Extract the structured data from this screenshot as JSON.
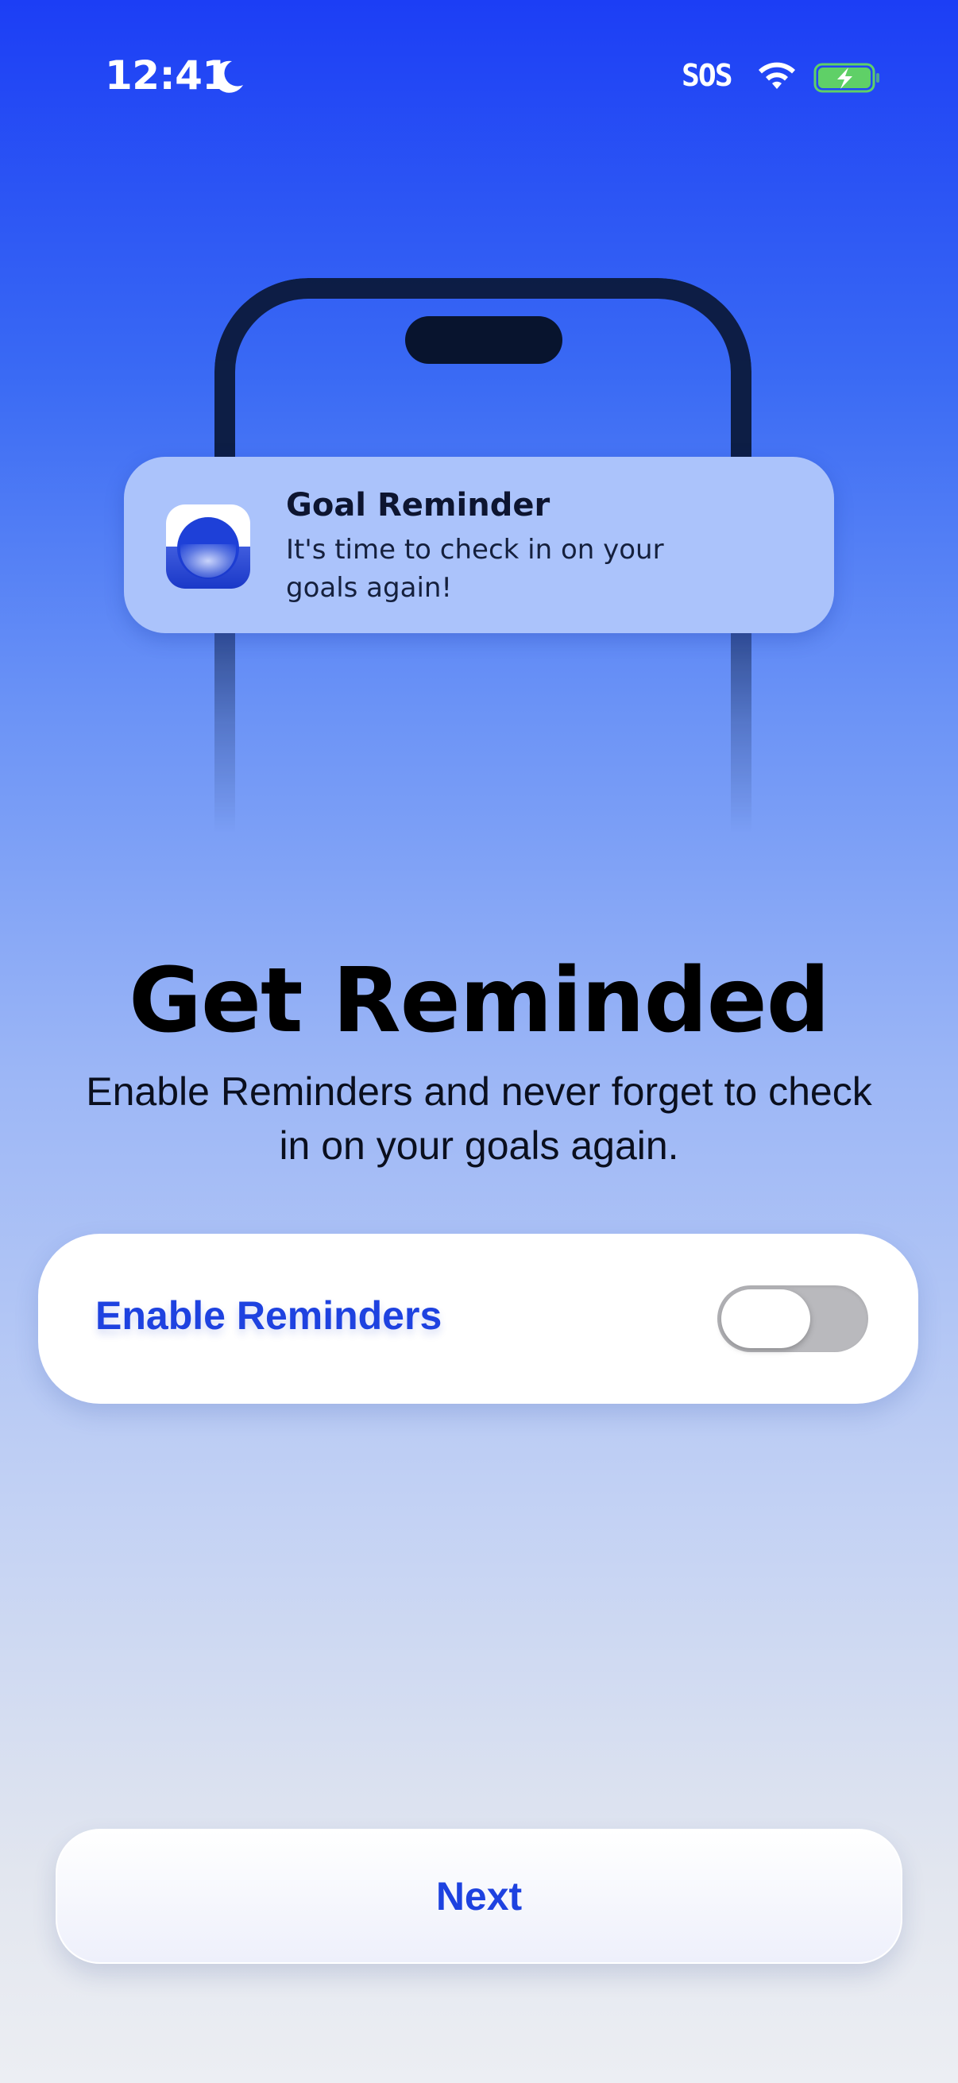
{
  "status_bar": {
    "time": "12:41",
    "focus_icon": "moon-icon",
    "carrier": "SOS",
    "wifi_icon": "wifi-icon",
    "battery_icon": "battery-charging-icon",
    "battery_color": "#5fd067"
  },
  "illustration": {
    "notification": {
      "title": "Goal Reminder",
      "body": "It's time to check in on your goals again!"
    }
  },
  "content": {
    "headline": "Get Reminded",
    "subtitle": "Enable Reminders and never forget to check in on your goals again."
  },
  "reminder_toggle": {
    "label": "Enable Reminders",
    "enabled": false
  },
  "footer": {
    "next_label": "Next"
  },
  "colors": {
    "accent": "#1e42e0",
    "background_top": "#1c3ef5",
    "background_bottom": "#eceef3"
  }
}
